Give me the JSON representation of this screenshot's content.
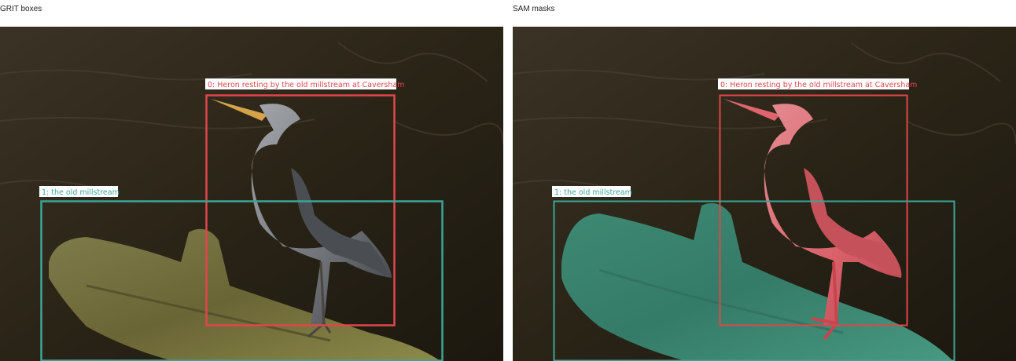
{
  "panels": {
    "left": {
      "title": "GRIT boxes"
    },
    "right": {
      "title": "SAM masks"
    }
  },
  "detections": [
    {
      "label": "0: Heron resting by the old millstream at Caversham",
      "color": "#e0464b"
    },
    {
      "label": "1: the old millstream",
      "color": "#3aa597"
    }
  ],
  "scene": {
    "water_color": "#2d2618",
    "heron_gray": "#7d8085",
    "heron_dark": "#3e4146",
    "beak_color": "#d6a24a",
    "log_color": "#6f6a3a",
    "heron_mask_color": "#e0646e",
    "log_mask_color": "#3d9e87"
  }
}
